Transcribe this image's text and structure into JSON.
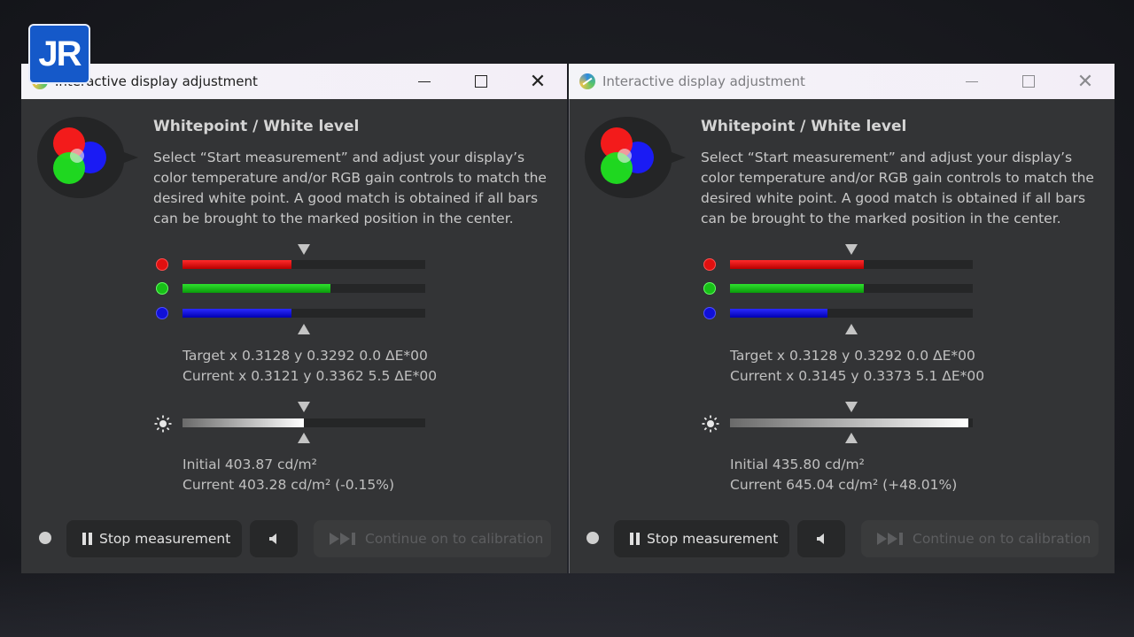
{
  "logo": {
    "text": "JR",
    "bg": "#1559c9"
  },
  "windows": [
    {
      "title": "Interactive display adjustment",
      "heading": "Whitepoint / White level",
      "description": "Select “Start measurement” and adjust your display’s color temperature and/or RGB gain controls to match the desired white point. A good match is obtained if all bars can be brought to the marked position in the center.",
      "bars": {
        "red": 0.45,
        "green": 0.61,
        "blue": 0.45,
        "luminance": 0.5
      },
      "target": "Target x 0.3128 y 0.3292 0.0 ΔE*00",
      "current": "Current x 0.3121 y 0.3362 5.5 ΔE*00",
      "initial_lum": "Initial 403.87 cd/m²",
      "current_lum": "Current 403.28 cd/m² (-0.15%)",
      "stop_label": "Stop measurement",
      "continue_label": "Continue on to calibration"
    },
    {
      "title": "Interactive display adjustment",
      "heading": "Whitepoint / White level",
      "description": "Select “Start measurement” and adjust your display’s color temperature and/or RGB gain controls to match the desired white point. A good match is obtained if all bars can be brought to the marked position in the center.",
      "bars": {
        "red": 0.55,
        "green": 0.55,
        "blue": 0.4,
        "luminance": 0.98
      },
      "target": "Target x 0.3128 y 0.3292 0.0 ΔE*00",
      "current": "Current x 0.3145 y 0.3373 5.1 ΔE*00",
      "initial_lum": "Initial 435.80 cd/m²",
      "current_lum": "Current 645.04 cd/m² (+48.01%)",
      "stop_label": "Stop measurement",
      "continue_label": "Continue on to calibration"
    }
  ],
  "icons": {
    "app": "displaycal-icon",
    "minimize": "minimize-icon",
    "maximize": "maximize-icon",
    "close": "close-icon",
    "rgb": "rgb-circles-icon",
    "brightness": "sun-icon",
    "pause": "pause-icon",
    "speaker": "speaker-icon",
    "skip": "skip-forward-icon"
  },
  "colors": {
    "red": "#e01010",
    "green": "#18c018",
    "blue": "#1010d8",
    "window_bg": "#333436"
  }
}
